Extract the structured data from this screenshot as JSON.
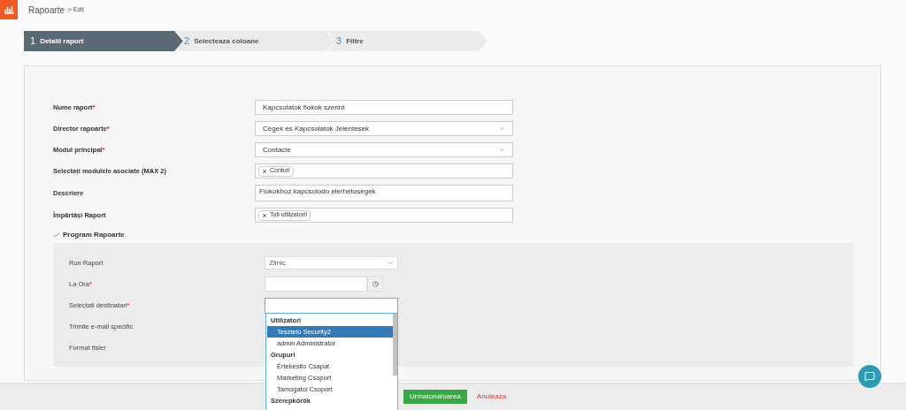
{
  "header": {
    "title": "Rapoarte",
    "separator": ">",
    "current": "Edit"
  },
  "steps": [
    {
      "number": "1",
      "label": "Detalii raport",
      "selected": true
    },
    {
      "number": "2",
      "label": "Selecteaza coloane",
      "selected": false
    },
    {
      "number": "3",
      "label": "Filtre",
      "selected": false
    }
  ],
  "fields": [
    {
      "label": "Nume raport",
      "required_mark": "*",
      "kind": "text",
      "value": "Kapcsolatok fiokok szerint"
    },
    {
      "label": "Director rapoarte",
      "required_mark": "*",
      "kind": "select",
      "value": "Cégek és Kapcsolatok Jelentések"
    },
    {
      "label": "Modul principal",
      "required_mark": "*",
      "kind": "select",
      "value": "Contacte"
    },
    {
      "label": "Selectați modulele asociate (MAX 2)",
      "kind": "tags",
      "tags": [
        "Conturi"
      ]
    },
    {
      "label": "Descriere",
      "kind": "textarea",
      "value": "Fiokokhoz kapcsolodo elerhetoségek"
    },
    {
      "label": "Împărtăși Raport",
      "kind": "tags",
      "tags": [
        "Toti utilizatorii"
      ]
    }
  ],
  "schedule": {
    "label": "Program Rapoarte",
    "checked": true,
    "rows": [
      {
        "label": "Run Raport",
        "kind": "select",
        "value": "Zilnic"
      },
      {
        "label": "La Ora",
        "required_mark": "*",
        "kind": "time"
      },
      {
        "label": "Selectati destinatari",
        "required_mark": "*",
        "kind": "multiselect"
      },
      {
        "label": "Trimite e-mail specific",
        "kind": "covered"
      },
      {
        "label": "Format fisier",
        "kind": "covered"
      }
    ]
  },
  "dropdown": {
    "groups": [
      {
        "label": "Utilizatori",
        "options": [
          {
            "label": "Tesztelo Security2",
            "selected": true
          },
          {
            "label": "admin Administrator",
            "selected": false
          }
        ]
      },
      {
        "label": "Grupuri",
        "options": [
          {
            "label": "Értekesito Csapat",
            "selected": false
          },
          {
            "label": "Marketing Csoport",
            "selected": false
          },
          {
            "label": "Tamogatoi Csoport",
            "selected": false
          }
        ]
      },
      {
        "label": "Szerepkörök"
      }
    ]
  },
  "footer": {
    "next": "Urmatorul/oarea",
    "cancel": "Anuleaza"
  }
}
